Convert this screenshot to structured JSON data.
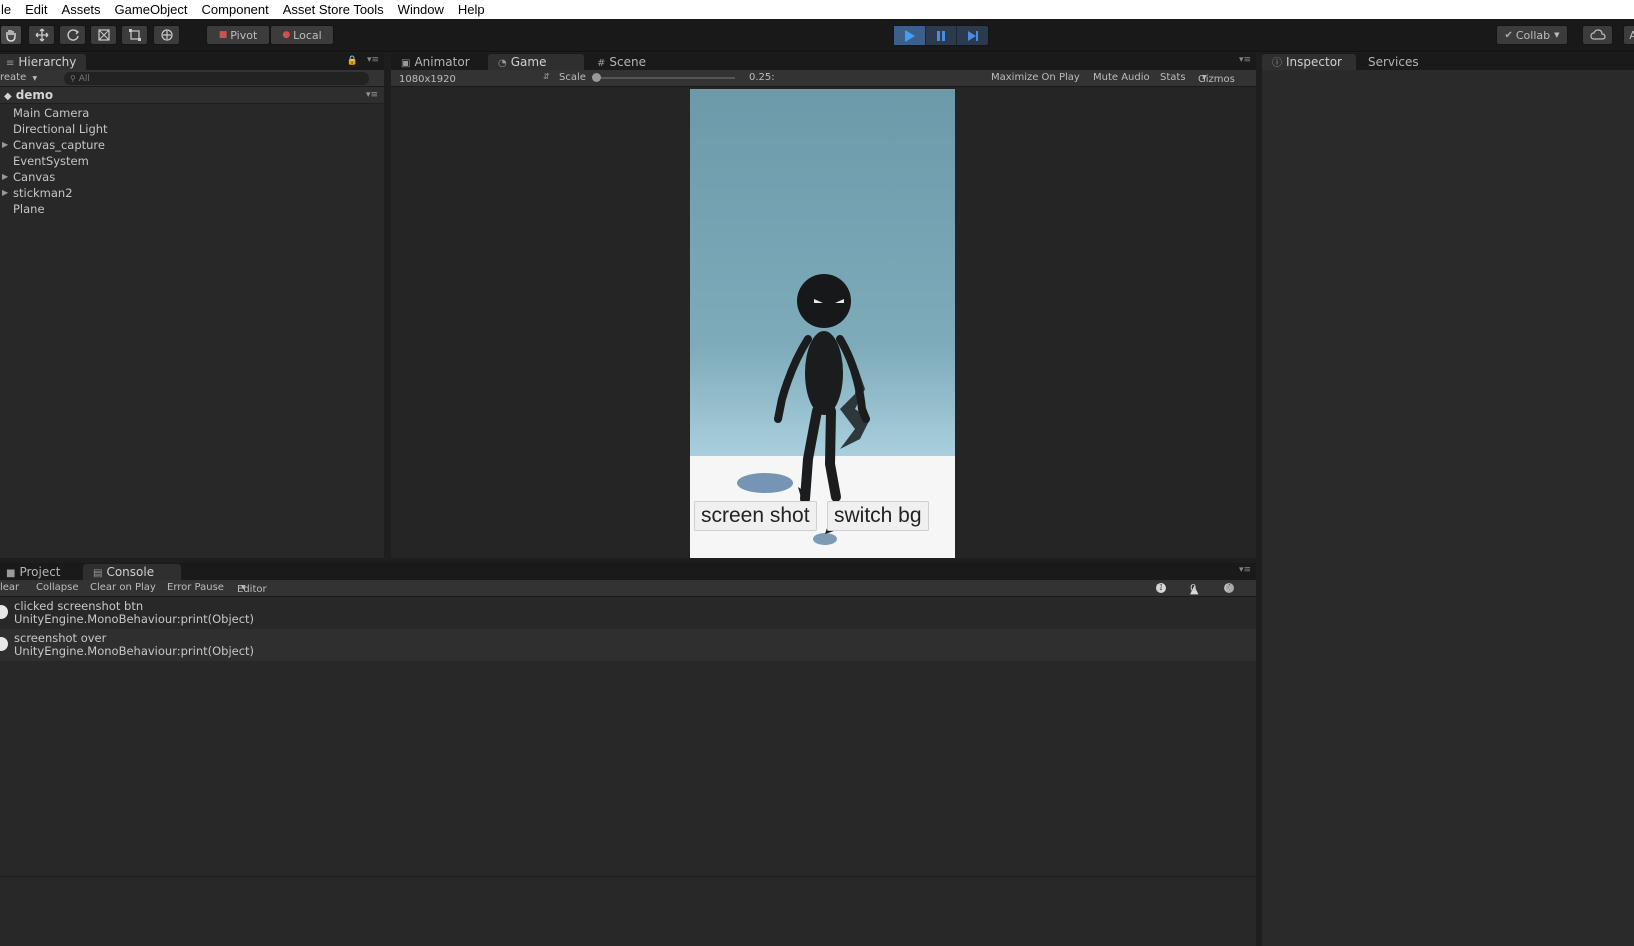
{
  "menu": [
    "le",
    "Edit",
    "Assets",
    "GameObject",
    "Component",
    "Asset Store Tools",
    "Window",
    "Help"
  ],
  "toolbar": {
    "pivot_label": "Pivot",
    "local_label": "Local",
    "collab_label": "Collab",
    "account_label": "A"
  },
  "hierarchy": {
    "tab_label": "Hierarchy",
    "create_label": "reate",
    "search_placeholder": "All",
    "scene_name": "demo",
    "items": [
      {
        "label": "Main Camera",
        "expandable": false
      },
      {
        "label": "Directional Light",
        "expandable": false
      },
      {
        "label": "Canvas_capture",
        "expandable": true
      },
      {
        "label": "EventSystem",
        "expandable": false
      },
      {
        "label": "Canvas",
        "expandable": true
      },
      {
        "label": "stickman2",
        "expandable": true
      },
      {
        "label": "Plane",
        "expandable": false
      }
    ]
  },
  "center_tabs": [
    {
      "label": "Animator",
      "icon": "animator-icon",
      "active": false
    },
    {
      "label": "Game",
      "icon": "game-icon",
      "active": true
    },
    {
      "label": "Scene",
      "icon": "scene-grid-icon",
      "active": false
    }
  ],
  "game": {
    "resolution": "1080x1920",
    "scale_label": "Scale",
    "scale_value": "0.25:",
    "maximize_label": "Maximize On Play",
    "mute_label": "Mute Audio",
    "stats_label": "Stats",
    "gizmos_label": "Gizmos",
    "buttons": [
      "screen shot",
      "switch bg"
    ]
  },
  "inspector": {
    "tabs": [
      "Inspector",
      "Services"
    ]
  },
  "bottom": {
    "tabs": [
      "Project",
      "Console"
    ],
    "console_toolbar": [
      "lear",
      "Collapse",
      "Clear on Play",
      "Error Pause",
      "Editor"
    ],
    "counts": {
      "errors": "2",
      "warnings": "0",
      "info": "0"
    },
    "logs": [
      {
        "line1": "clicked screenshot btn",
        "line2": "UnityEngine.MonoBehaviour:print(Object)"
      },
      {
        "line1": "screenshot over",
        "line2": "UnityEngine.MonoBehaviour:print(Object)"
      }
    ]
  },
  "colors": {
    "panel_bg": "#282828",
    "play_active": "#3d5f8c",
    "sky_top": "#6c9aa9",
    "ground": "#f6f6f6"
  }
}
